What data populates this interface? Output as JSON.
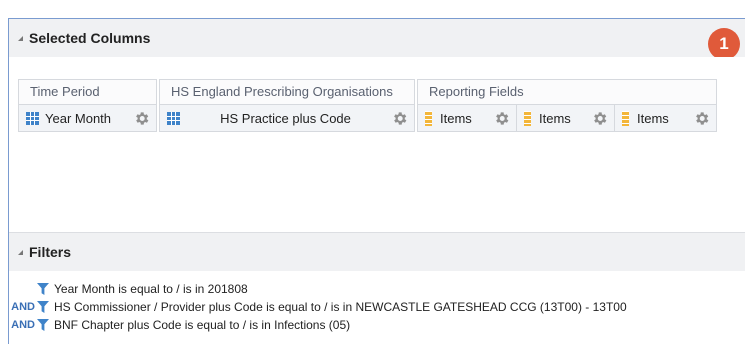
{
  "selected_columns": {
    "title": "Selected Columns",
    "badge": "1",
    "groups": [
      {
        "title": "Time Period",
        "chips": [
          {
            "label": "Year Month",
            "icon": "grid-icon"
          }
        ]
      },
      {
        "title": "HS England Prescribing Organisations",
        "chips": [
          {
            "label": "HS Practice plus Code",
            "icon": "grid-icon"
          }
        ]
      },
      {
        "title": "Reporting Fields",
        "chips": [
          {
            "label": "Items",
            "icon": "ruler-icon"
          },
          {
            "label": "Items",
            "icon": "ruler-icon"
          },
          {
            "label": "Items",
            "icon": "ruler-icon"
          }
        ]
      }
    ]
  },
  "filters": {
    "title": "Filters",
    "items": [
      {
        "conjunction": "",
        "text": "Year Month is equal to / is in  201808"
      },
      {
        "conjunction": "AND",
        "text": "HS Commissioner / Provider plus Code is equal to / is in  NEWCASTLE GATESHEAD CCG (13T00) - 13T00"
      },
      {
        "conjunction": "AND",
        "text": "BNF Chapter plus Code is equal to / is in  Infections (05)"
      }
    ]
  },
  "colors": {
    "accent": "#3a6fb5",
    "badge": "#e05a3a",
    "measure": "#f3b63a",
    "attribute": "#3f83c9"
  }
}
